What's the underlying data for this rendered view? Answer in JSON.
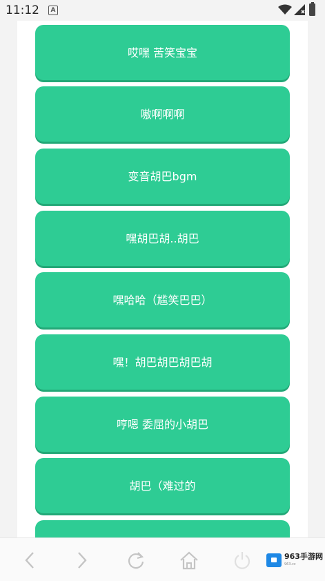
{
  "status_bar": {
    "time": "11:12",
    "notification_icon": "a-badge-icon",
    "wifi_icon": "wifi-icon",
    "signal_icon": "signal-icon",
    "battery_icon": "battery-icon"
  },
  "sounds": [
    {
      "label": "哎嘿 苦笑宝宝"
    },
    {
      "label": "嗷啊啊啊"
    },
    {
      "label": "变音胡巴bgm"
    },
    {
      "label": "嘿胡巴胡..胡巴"
    },
    {
      "label": "嘿哈哈（尴笑巴巴）"
    },
    {
      "label": "嘿！胡巴胡巴胡巴胡"
    },
    {
      "label": "哼嗯 委屈的小胡巴"
    },
    {
      "label": "胡巴（难过的"
    },
    {
      "label": ""
    }
  ],
  "bottom_nav": {
    "back_icon": "chevron-left-icon",
    "forward_icon": "chevron-right-icon",
    "refresh_icon": "refresh-icon",
    "home_icon": "home-icon",
    "power_icon": "power-icon",
    "logo_text": "963手游网",
    "logo_subtext": "963.cc"
  },
  "colors": {
    "button": "#2ecc94",
    "button_shadow": "#22a877",
    "button_text": "#ffffff",
    "panel": "#ffffff",
    "background": "#f3f3f3"
  }
}
